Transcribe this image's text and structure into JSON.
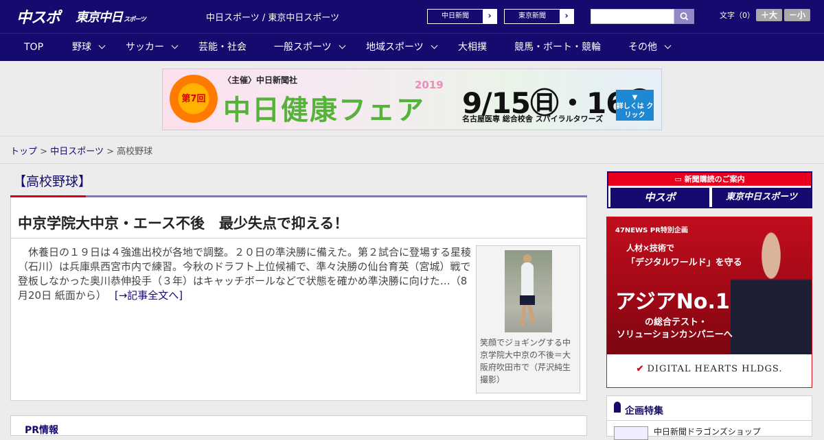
{
  "header": {
    "logo_chuspo": "中スポ",
    "logo_tokyo": "東京中日",
    "logo_tokyo_small": "スポーツ",
    "site_title": "中日スポーツ / 東京中日スポーツ",
    "paper_links": [
      "中日新聞",
      "東京新聞"
    ],
    "search_placeholder": "",
    "font_label": "文字（0）",
    "font_larger": "＋大",
    "font_smaller": "－小"
  },
  "nav": {
    "items": [
      {
        "label": "TOP",
        "dropdown": false
      },
      {
        "label": "野球",
        "dropdown": true
      },
      {
        "label": "サッカー",
        "dropdown": true
      },
      {
        "label": "芸能・社会",
        "dropdown": false
      },
      {
        "label": "一般スポーツ",
        "dropdown": true
      },
      {
        "label": "地域スポーツ",
        "dropdown": true
      },
      {
        "label": "大相撲",
        "dropdown": false
      },
      {
        "label": "競馬・ボート・競輪",
        "dropdown": false
      },
      {
        "label": "その他",
        "dropdown": true
      }
    ]
  },
  "banner": {
    "badge": "第7回",
    "host": "〈主催〉中日新聞社",
    "title": "中日健康フェア",
    "year": "2019",
    "date": "9/15㊐・16㊗",
    "venue": "名古屋医専 総合校舎 スパイラルタワーズ",
    "more": "詳しくは クリック"
  },
  "breadcrumb": {
    "home": "トップ",
    "section": "中日スポーツ",
    "current": "高校野球",
    "separator": ">"
  },
  "category": {
    "label": "【高校野球】"
  },
  "article": {
    "title": "中京学院大中京・エース不後　最少失点で抑える！",
    "body": "休養日の１９日は４強進出校が各地で調整。２０日の準決勝に備えた。第２試合に登場する星稜（石川）は兵庫県西宮市内で練習。今秋のドラフト上位候補で、準々決勝の仙台育英（宮城）戦で登板しなかった奥川恭伸投手（３年）はキャッチボールなどで状態を確かめ準決勝に向けた…（8月20日 紙面から）",
    "more_link": "[→記事全文へ]",
    "photo_caption": "笑顔でジョギングする中京学院大中京の不後＝大阪府吹田市で（芹沢純生撮影）"
  },
  "pr": {
    "label": "PR情報"
  },
  "sidebar": {
    "subscribe_head": "新聞購読のご案内",
    "subscribe_logos": [
      "中スポ",
      "東京中日スポーツ"
    ],
    "ad": {
      "label": "47NEWS PR特別企画",
      "line1": "人材×技術で",
      "line2": "「デジタルワールド」を守る",
      "line3": "アジアNo.1",
      "line4": "の総合テスト・",
      "line5": "ソリューションカンパニーへ",
      "brand": "DIGITAL HEARTS HLDGS."
    },
    "feature_title": "企画特集",
    "feature_item": "中日新聞ドラゴンズショップ"
  },
  "colors": {
    "brand_navy": "#150a6e",
    "accent_red": "#d7001a",
    "accent_purple": "#7e74c8"
  }
}
